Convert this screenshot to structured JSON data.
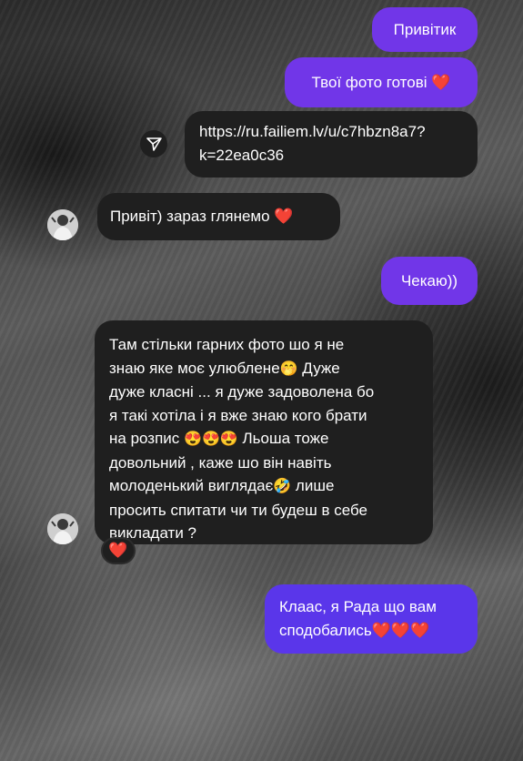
{
  "chat": {
    "messages": [
      {
        "sender": "me",
        "text": "Привітик"
      },
      {
        "sender": "me",
        "text": "Твої фото готові",
        "emoji": "❤️"
      },
      {
        "sender": "me",
        "text_line1": "https://ru.failiem.lv/u/c7hbzn8a7?",
        "text_line2": "k=22ea0c36"
      },
      {
        "sender": "them",
        "text": "Привіт) зараз глянемо",
        "emoji": "❤️"
      },
      {
        "sender": "me",
        "text": "Чекаю))"
      },
      {
        "sender": "them",
        "lines": [
          "Там стільки гарних фото шо я не",
          "знаю яке моє улюблене",
          "🤭",
          " Дуже",
          "дуже класні ... я дуже задоволена бо",
          "я такі хотіла і я вже знаю кого брати",
          "на розпис ",
          "😍😍😍",
          " Льоша тоже",
          "довольний , каже шо він навіть",
          "молоденький виглядає",
          "🤣",
          " лише",
          "просить спитати чи ти будеш в себе",
          "викладати ?"
        ],
        "reaction": "❤️"
      },
      {
        "sender": "me2",
        "line1": "Клаас, я Рада що вам",
        "line2": "сподобались",
        "emoji": "❤️❤️❤️"
      }
    ]
  },
  "colors": {
    "outgoing_purple": "#7136e8",
    "outgoing_blue": "#5a36ea",
    "incoming_dark": "#1f1f1f",
    "heart_red": "#e0343c"
  },
  "icons": {
    "share": "share-icon",
    "avatar": "avatar"
  }
}
